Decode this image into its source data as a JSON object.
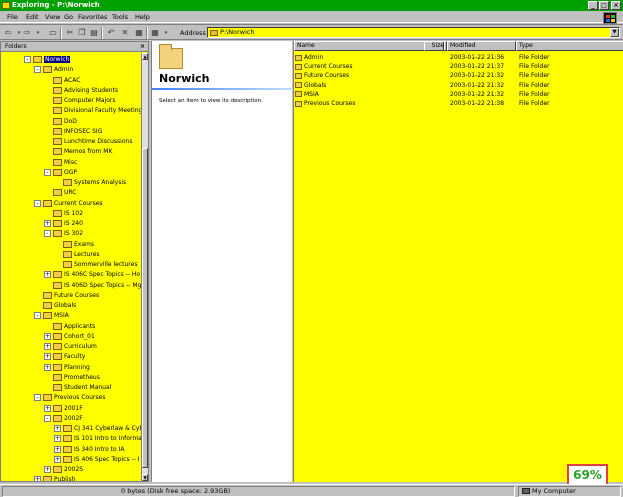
{
  "window": {
    "title": "Exploring - P:\\Norwich"
  },
  "menu": [
    "File",
    "Edit",
    "View",
    "Go",
    "Favorites",
    "Tools",
    "Help"
  ],
  "address": {
    "label": "Address",
    "value": "P:\\Norwich"
  },
  "tree": {
    "header": "Folders",
    "nodes": [
      {
        "label": "Norwich",
        "level": 0,
        "exp": "-",
        "selected": true
      },
      {
        "label": "Admin",
        "level": 1,
        "exp": "-"
      },
      {
        "label": "ACAC",
        "level": 2,
        "exp": ""
      },
      {
        "label": "Advising Students",
        "level": 2,
        "exp": ""
      },
      {
        "label": "Computer Majors",
        "level": 2,
        "exp": ""
      },
      {
        "label": "Divisional Faculty Meetings",
        "level": 2,
        "exp": ""
      },
      {
        "label": "DoD",
        "level": 2,
        "exp": ""
      },
      {
        "label": "INFOSEC SIG",
        "level": 2,
        "exp": ""
      },
      {
        "label": "Lunchtime Discussions",
        "level": 2,
        "exp": ""
      },
      {
        "label": "Memos from MK",
        "level": 2,
        "exp": ""
      },
      {
        "label": "Misc",
        "level": 2,
        "exp": ""
      },
      {
        "label": "OGP",
        "level": 2,
        "exp": "-"
      },
      {
        "label": "Systems Analysis",
        "level": 3,
        "exp": ""
      },
      {
        "label": "URC",
        "level": 2,
        "exp": ""
      },
      {
        "label": "Current Courses",
        "level": 1,
        "exp": "-"
      },
      {
        "label": "IS 102",
        "level": 2,
        "exp": ""
      },
      {
        "label": "IS 240",
        "level": 2,
        "exp": "+"
      },
      {
        "label": "IS 302",
        "level": 2,
        "exp": "-"
      },
      {
        "label": "Exams",
        "level": 3,
        "exp": ""
      },
      {
        "label": "Lectures",
        "level": 3,
        "exp": ""
      },
      {
        "label": "Sommerville lectures",
        "level": 3,
        "exp": ""
      },
      {
        "label": "IS 406C Spec Topics -- Ho",
        "level": 2,
        "exp": "+"
      },
      {
        "label": "IS 406D Spec Topics -- Mg",
        "level": 2,
        "exp": ""
      },
      {
        "label": "Future Courses",
        "level": 1,
        "exp": ""
      },
      {
        "label": "Globals",
        "level": 1,
        "exp": ""
      },
      {
        "label": "MSIA",
        "level": 1,
        "exp": "-"
      },
      {
        "label": "Applicants",
        "level": 2,
        "exp": ""
      },
      {
        "label": "Cohort_01",
        "level": 2,
        "exp": "+"
      },
      {
        "label": "Curriculum",
        "level": 2,
        "exp": "+"
      },
      {
        "label": "Faculty",
        "level": 2,
        "exp": "+"
      },
      {
        "label": "Planning",
        "level": 2,
        "exp": "+"
      },
      {
        "label": "Prometheus",
        "level": 2,
        "exp": ""
      },
      {
        "label": "Student Manual",
        "level": 2,
        "exp": ""
      },
      {
        "label": "Previous Courses",
        "level": 1,
        "exp": "-"
      },
      {
        "label": "2001F",
        "level": 2,
        "exp": "+"
      },
      {
        "label": "2002F",
        "level": 2,
        "exp": "-"
      },
      {
        "label": "CJ 341 Cyberlaw & Cyb",
        "level": 3,
        "exp": "+"
      },
      {
        "label": "IS 101 Intro to Informa",
        "level": 3,
        "exp": "+"
      },
      {
        "label": "IS 340 Intro to IA",
        "level": 3,
        "exp": "+"
      },
      {
        "label": "IS 406 Spec Topics -- I",
        "level": 3,
        "exp": "+"
      },
      {
        "label": "2002S",
        "level": 2,
        "exp": "+"
      },
      {
        "label": "Publish",
        "level": 1,
        "exp": "+"
      }
    ]
  },
  "description": {
    "title": "Norwich",
    "text": "Select an item to view its description."
  },
  "list": {
    "columns": [
      "Name",
      "Size",
      "Modified",
      "Type"
    ],
    "rows": [
      {
        "name": "Admin",
        "size": "",
        "modified": "2003-01-22 21:36",
        "type": "File Folder"
      },
      {
        "name": "Current Courses",
        "size": "",
        "modified": "2003-01-22 21:37",
        "type": "File Folder"
      },
      {
        "name": "Future Courses",
        "size": "",
        "modified": "2003-01-22 21:32",
        "type": "File Folder"
      },
      {
        "name": "Globals",
        "size": "",
        "modified": "2003-01-22 21:32",
        "type": "File Folder"
      },
      {
        "name": "MSIA",
        "size": "",
        "modified": "2003-01-22 21:32",
        "type": "File Folder"
      },
      {
        "name": "Previous Courses",
        "size": "",
        "modified": "2003-01-22 21:38",
        "type": "File Folder"
      }
    ]
  },
  "status": {
    "left": "0 bytes (Disk free space: 2.93GB)",
    "right": "My Computer"
  },
  "zoom": "69%"
}
